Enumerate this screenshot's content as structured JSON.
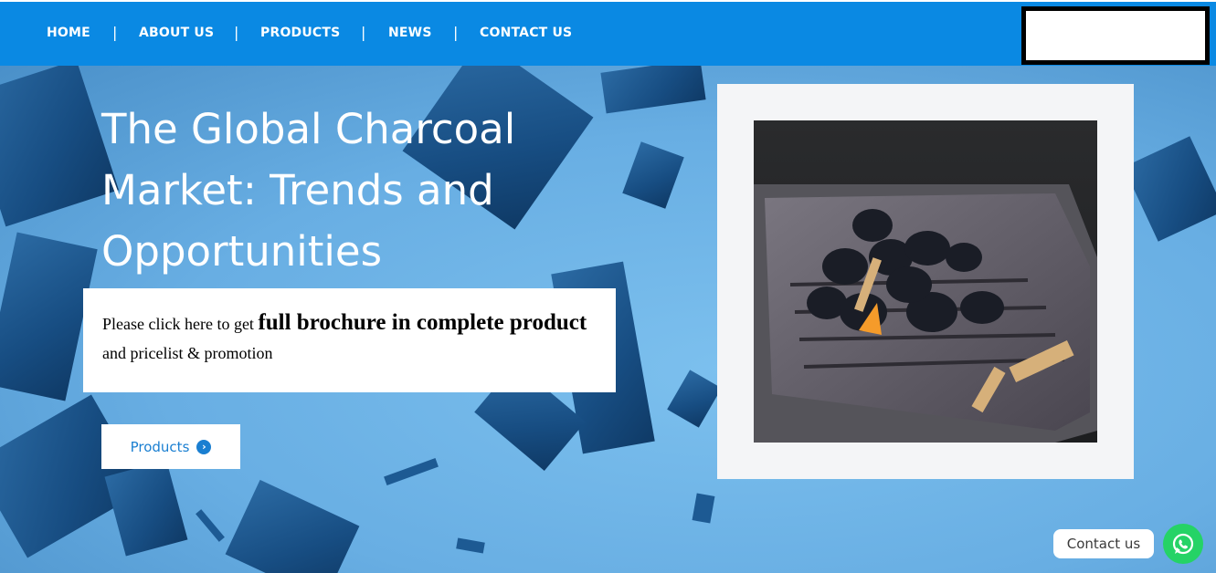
{
  "nav": {
    "items": [
      {
        "label": "HOME"
      },
      {
        "label": "ABOUT US"
      },
      {
        "label": "PRODUCTS"
      },
      {
        "label": "NEWS"
      },
      {
        "label": "CONTACT US"
      }
    ],
    "separator": "|"
  },
  "hero": {
    "title": "The Global Charcoal Market: Trends and Opportunities",
    "promo": {
      "part1": "Please click here to get ",
      "bold": "full  brochure in complete product",
      "part2": " and pricelist & promotion"
    },
    "button_label": "Products",
    "button_icon": "chevron-right-circle-icon"
  },
  "contact": {
    "label": "Contact us",
    "icon": "whatsapp-icon"
  },
  "colors": {
    "nav_bg": "#0a89e3",
    "hero_bg": "#6fb4e6",
    "accent": "#1a7fd1",
    "whatsapp": "#25d366"
  }
}
